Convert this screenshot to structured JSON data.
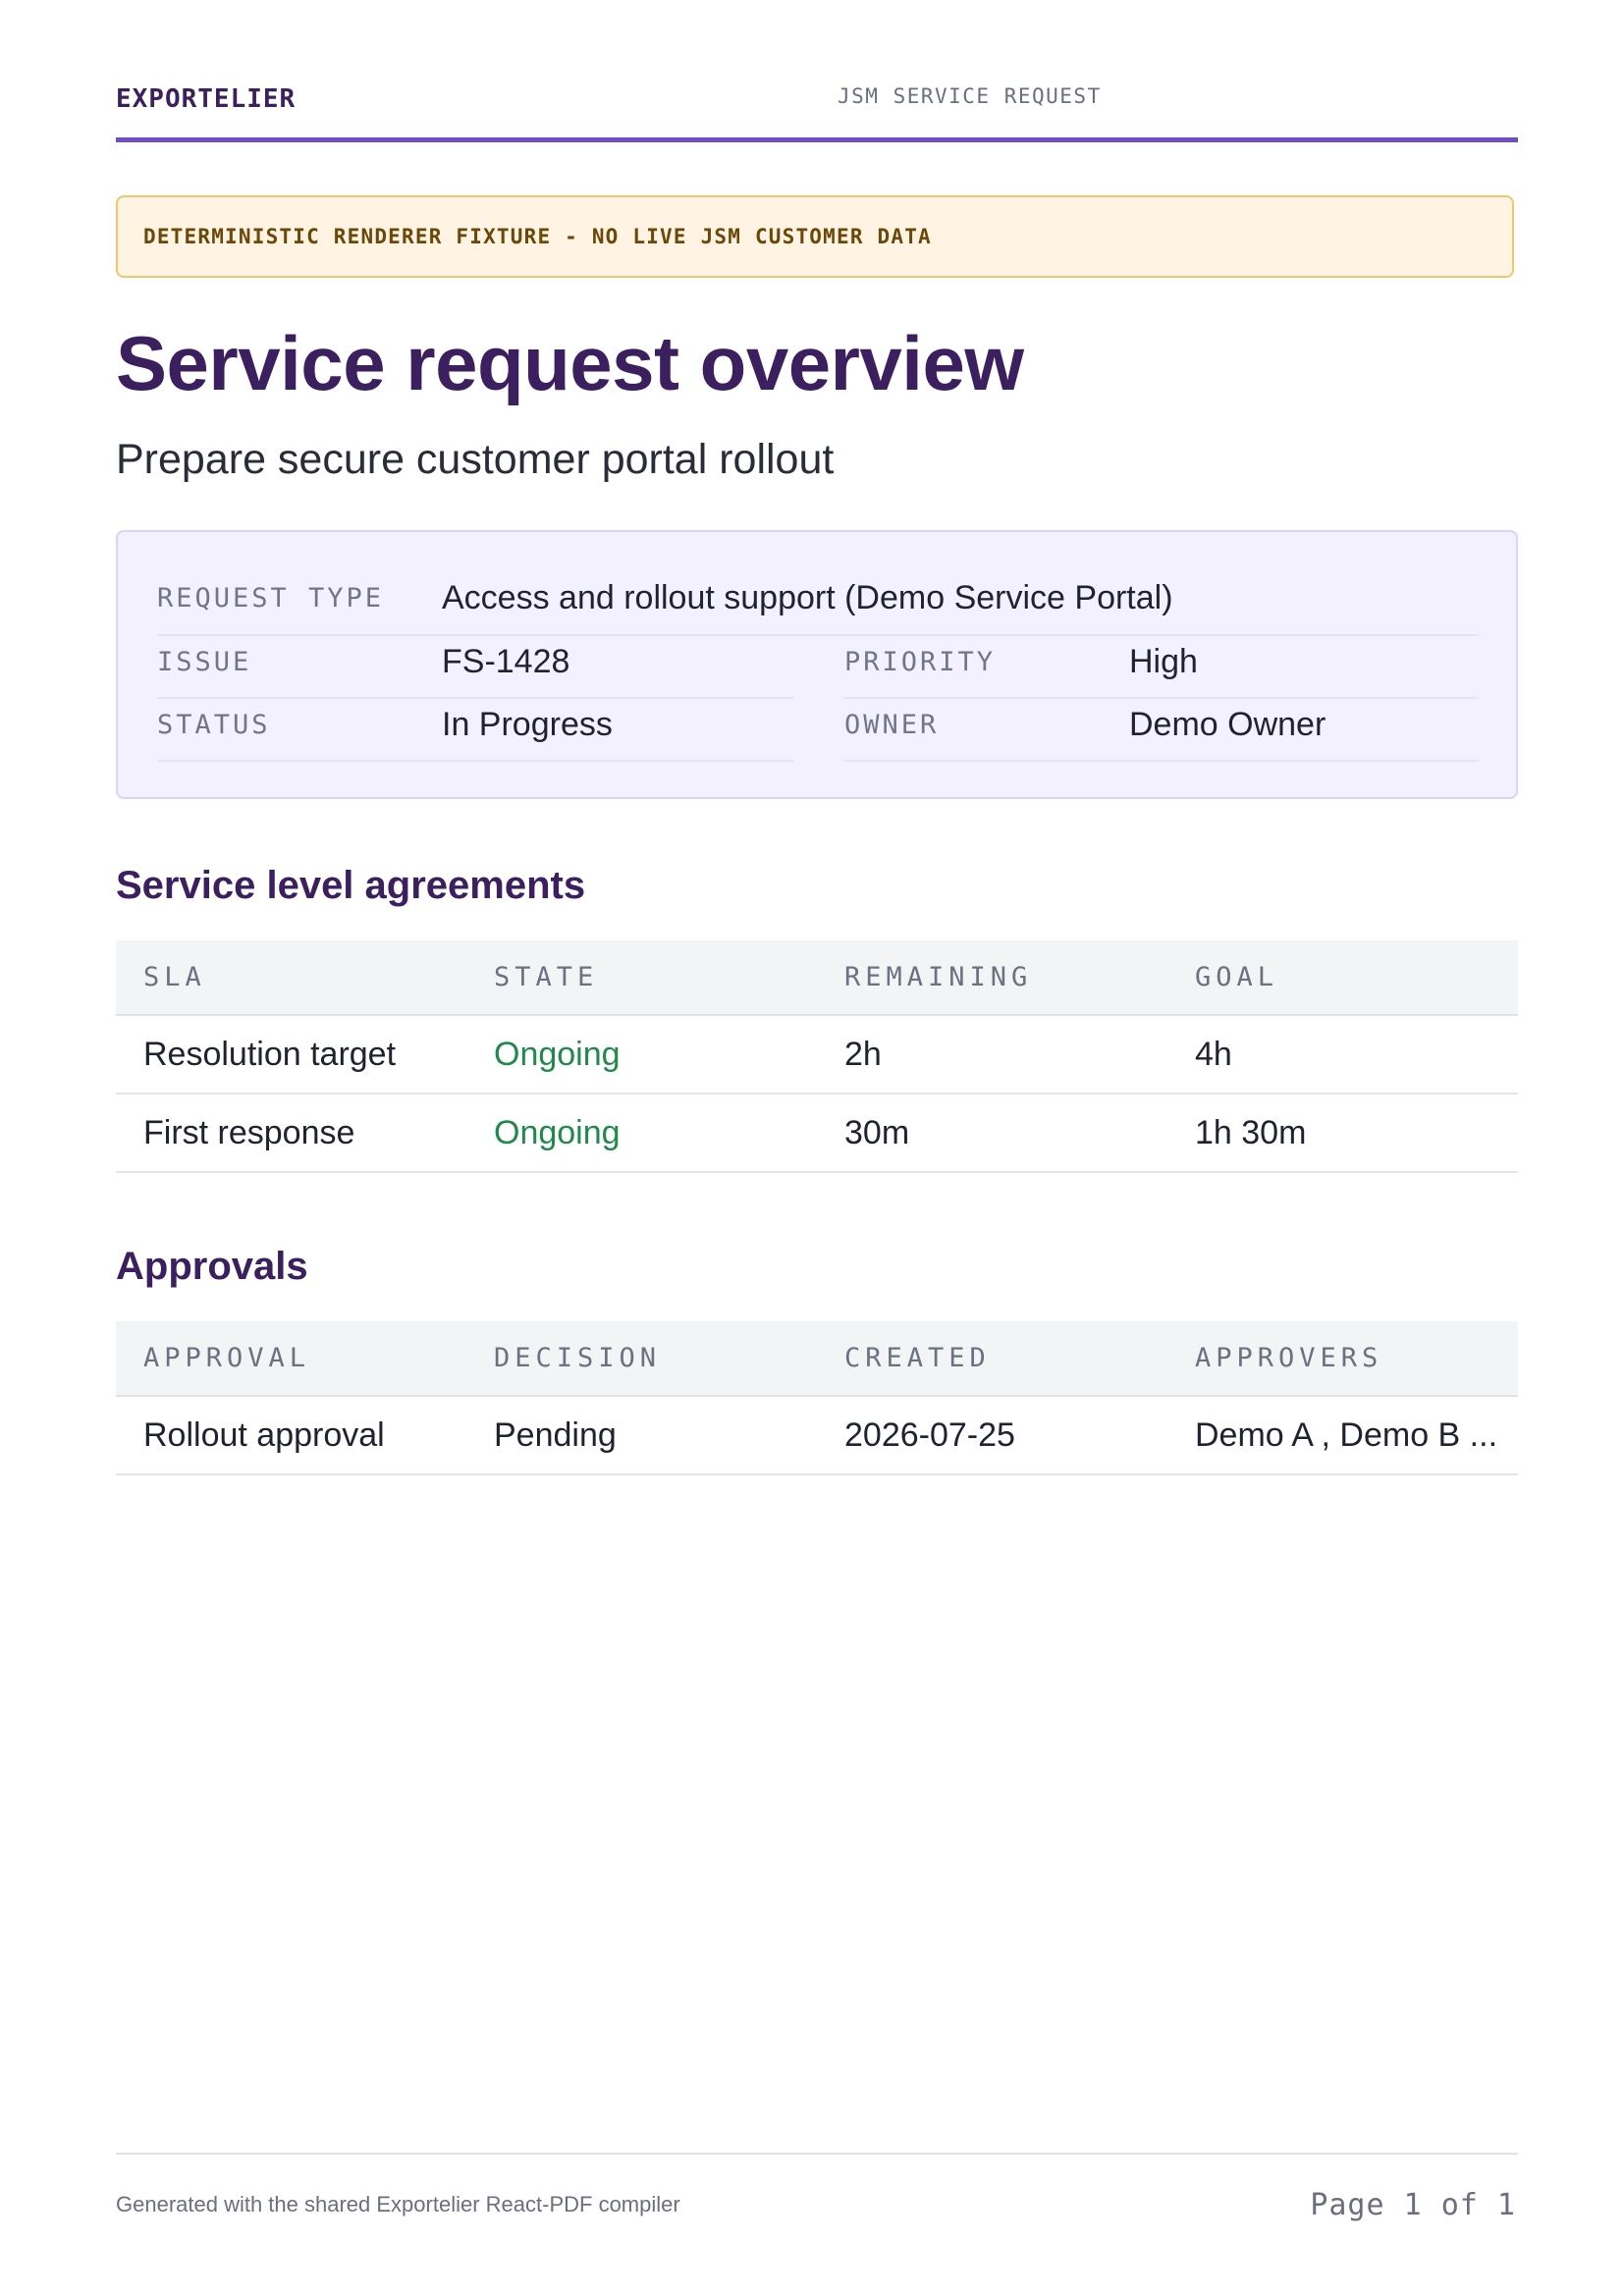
{
  "header": {
    "brand": "EXPORTELIER",
    "doc_kind": "JSM SERVICE REQUEST"
  },
  "banner": {
    "text": "DETERMINISTIC RENDERER FIXTURE - NO LIVE JSM CUSTOMER DATA"
  },
  "title": "Service request overview",
  "subtitle": "Prepare secure customer portal rollout",
  "summary": {
    "request_type": {
      "label": "REQUEST TYPE",
      "value": "Access and rollout support (Demo Service Portal)"
    },
    "issue": {
      "label": "ISSUE",
      "value": "FS-1428"
    },
    "priority": {
      "label": "PRIORITY",
      "value": "High"
    },
    "status": {
      "label": "STATUS",
      "value": "In Progress"
    },
    "owner": {
      "label": "OWNER",
      "value": "Demo Owner"
    }
  },
  "sla_section": {
    "heading": "Service level agreements",
    "columns": [
      "SLA",
      "STATE",
      "REMAINING",
      "GOAL"
    ],
    "rows": [
      [
        "Resolution target",
        "Ongoing",
        "2h",
        "4h"
      ],
      [
        "First response",
        "Ongoing",
        "30m",
        "1h 30m"
      ]
    ]
  },
  "approvals_section": {
    "heading": "Approvals",
    "columns": [
      "APPROVAL",
      "DECISION",
      "CREATED",
      "APPROVERS"
    ],
    "rows": [
      [
        "Rollout approval",
        "Pending",
        "2026-07-25",
        "Demo A , Demo B ..."
      ]
    ]
  },
  "footer": {
    "note": "Generated with the shared Exportelier React-PDF compiler",
    "page": "Page 1 of 1"
  },
  "colors": {
    "brand": "#3b1f5e",
    "accent": "#6f4cc9",
    "ongoing": "#1f8a4c",
    "banner_bg": "#fff4e3"
  }
}
